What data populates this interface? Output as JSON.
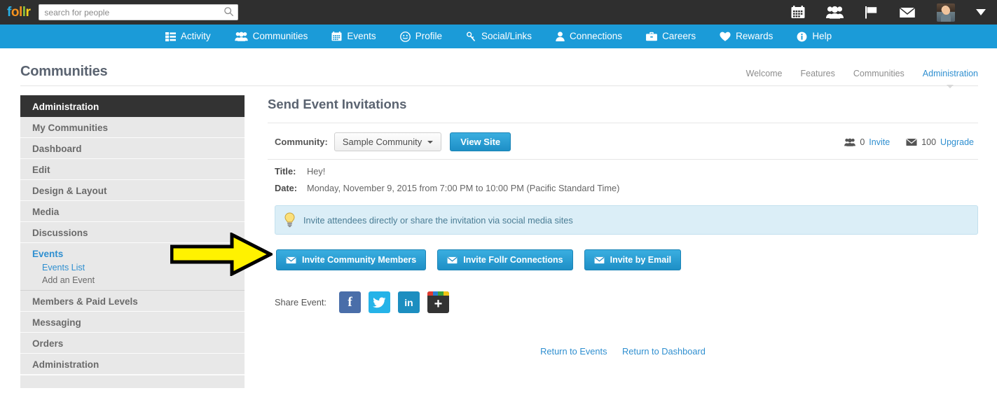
{
  "topbar": {
    "logo": {
      "letters": [
        "f",
        "o",
        "l",
        "l",
        "r"
      ]
    },
    "search": {
      "value": "",
      "placeholder": "search for people"
    },
    "icons": [
      {
        "name": "calendar-icon"
      },
      {
        "name": "group-icon"
      },
      {
        "name": "flag-icon"
      },
      {
        "name": "envelope-icon"
      }
    ],
    "avatar_name": "user-avatar",
    "caret_name": "user-menu-caret"
  },
  "nav": {
    "items": [
      {
        "label": "Activity",
        "icon": "list-icon"
      },
      {
        "label": "Communities",
        "icon": "group-icon"
      },
      {
        "label": "Events",
        "icon": "calendar-icon"
      },
      {
        "label": "Profile",
        "icon": "smiley-icon"
      },
      {
        "label": "Social/Links",
        "icon": "link-icon"
      },
      {
        "label": "Connections",
        "icon": "user-icon"
      },
      {
        "label": "Careers",
        "icon": "briefcase-icon"
      },
      {
        "label": "Rewards",
        "icon": "heart-icon"
      },
      {
        "label": "Help",
        "icon": "info-icon"
      }
    ]
  },
  "page": {
    "title": "Communities",
    "tabs": [
      {
        "label": "Welcome",
        "active": false
      },
      {
        "label": "Features",
        "active": false
      },
      {
        "label": "Communities",
        "active": false
      },
      {
        "label": "Administration",
        "active": true
      }
    ]
  },
  "sidebar": {
    "header": "Administration",
    "items": [
      {
        "label": "My Communities"
      },
      {
        "label": "Dashboard"
      },
      {
        "label": "Edit"
      },
      {
        "label": "Design & Layout"
      },
      {
        "label": "Media"
      },
      {
        "label": "Discussions"
      },
      {
        "label": "Events",
        "active": true
      },
      {
        "label": "Members & Paid Levels"
      },
      {
        "label": "Messaging"
      },
      {
        "label": "Orders"
      },
      {
        "label": "Administration"
      }
    ],
    "events_sub": [
      {
        "label": "Events List",
        "active": true
      },
      {
        "label": "Add an Event",
        "active": false
      }
    ]
  },
  "main": {
    "title": "Send Event Invitations",
    "community": {
      "label": "Community:",
      "selected": "Sample Community",
      "view_site_label": "View Site"
    },
    "quota": {
      "invite_count": "0",
      "invite_label": "Invite",
      "upgrade_count": "100",
      "upgrade_label": "Upgrade"
    },
    "details": [
      {
        "key": "Title:",
        "value": "Hey!"
      },
      {
        "key": "Date:",
        "value": "Monday, November 9, 2015 from 7:00 PM to 10:00 PM (Pacific Standard Time)"
      }
    ],
    "alert": {
      "icon": "lightbulb-icon",
      "text": "Invite attendees directly or share the invitation via social media sites"
    },
    "invite_buttons": [
      {
        "label": "Invite Community Members",
        "icon": "envelope-icon"
      },
      {
        "label": "Invite Follr Connections",
        "icon": "envelope-icon"
      },
      {
        "label": "Invite by Email",
        "icon": "envelope-icon"
      }
    ],
    "share": {
      "label": "Share Event:",
      "buttons": [
        {
          "name": "facebook-share-button",
          "glyph": "f"
        },
        {
          "name": "twitter-share-button",
          "glyph": ""
        },
        {
          "name": "linkedin-share-button",
          "glyph": "in"
        },
        {
          "name": "addthis-share-button",
          "glyph": "+"
        }
      ]
    },
    "returns": [
      {
        "label": "Return to Events"
      },
      {
        "label": "Return to Dashboard"
      }
    ]
  },
  "annotation": {
    "name": "yellow-arrow-annotation",
    "color": "#FFF200"
  },
  "colors": {
    "nav_blue": "#1b9bd8",
    "link_blue": "#2f8fd0",
    "topbar_dark": "#2f2f2f",
    "sidebar_header": "#333333",
    "sidebar_item": "#e8e8e8",
    "alert_bg": "#dbeef7"
  }
}
